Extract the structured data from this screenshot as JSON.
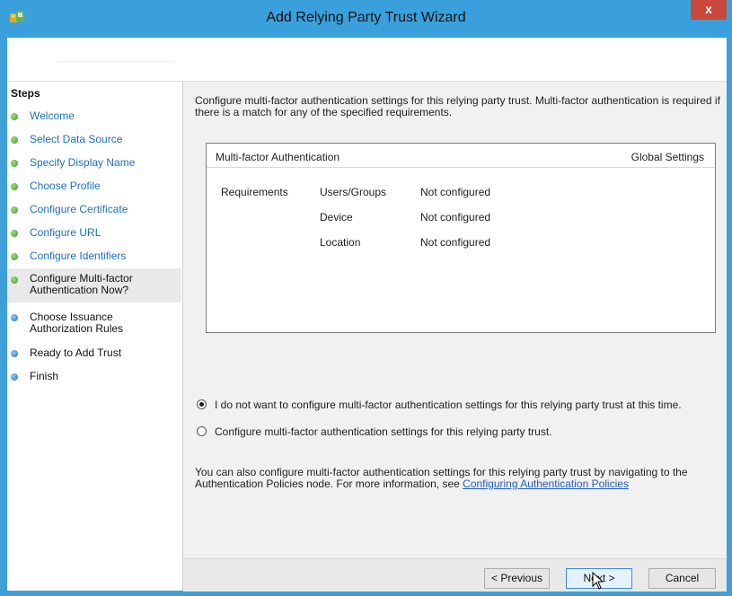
{
  "window": {
    "title": "Add Relying Party Trust Wizard",
    "close_label": "x",
    "colors": {
      "titlebar": "#3aa0db",
      "close": "#c9473b",
      "link": "#1f6fbf"
    }
  },
  "steps": {
    "title": "Steps",
    "items": [
      {
        "label": "Welcome",
        "state": "done"
      },
      {
        "label": "Select Data Source",
        "state": "done"
      },
      {
        "label": "Specify Display Name",
        "state": "done"
      },
      {
        "label": "Choose Profile",
        "state": "done"
      },
      {
        "label": "Configure Certificate",
        "state": "done"
      },
      {
        "label": "Configure URL",
        "state": "done"
      },
      {
        "label": "Configure Identifiers",
        "state": "done"
      },
      {
        "label_line1": "Configure Multi-factor",
        "label_line2": "Authentication Now?",
        "state": "current"
      },
      {
        "label_line1": "Choose Issuance",
        "label_line2": "Authorization Rules",
        "state": "todo"
      },
      {
        "label": "Ready to Add Trust",
        "state": "todo"
      },
      {
        "label": "Finish",
        "state": "todo"
      }
    ]
  },
  "main": {
    "intro_line1": "Configure multi-factor authentication settings for this relying party trust. Multi-factor authentication is required if",
    "intro_line2": "there is a match for any of the specified requirements.",
    "mfa_table": {
      "header_left": "Multi-factor Authentication",
      "header_right": "Global Settings",
      "requirements_label": "Requirements",
      "rows": [
        {
          "key": "Users/Groups",
          "value": "Not configured"
        },
        {
          "key": "Device",
          "value": "Not configured"
        },
        {
          "key": "Location",
          "value": "Not configured"
        }
      ]
    },
    "radio_options": [
      {
        "label": "I do not want to configure multi-factor authentication settings for this relying party trust at this time.",
        "checked": true
      },
      {
        "label": "Configure multi-factor authentication settings for this relying party trust.",
        "checked": false
      }
    ],
    "note_line1": "You can also configure multi-factor authentication settings for this relying party trust by navigating to the",
    "note_line2_prefix": "Authentication Policies node. For more information, see ",
    "note_link": "Configuring Authentication Policies"
  },
  "buttons": {
    "previous": "< Previous",
    "next": "Next >",
    "cancel": "Cancel"
  }
}
